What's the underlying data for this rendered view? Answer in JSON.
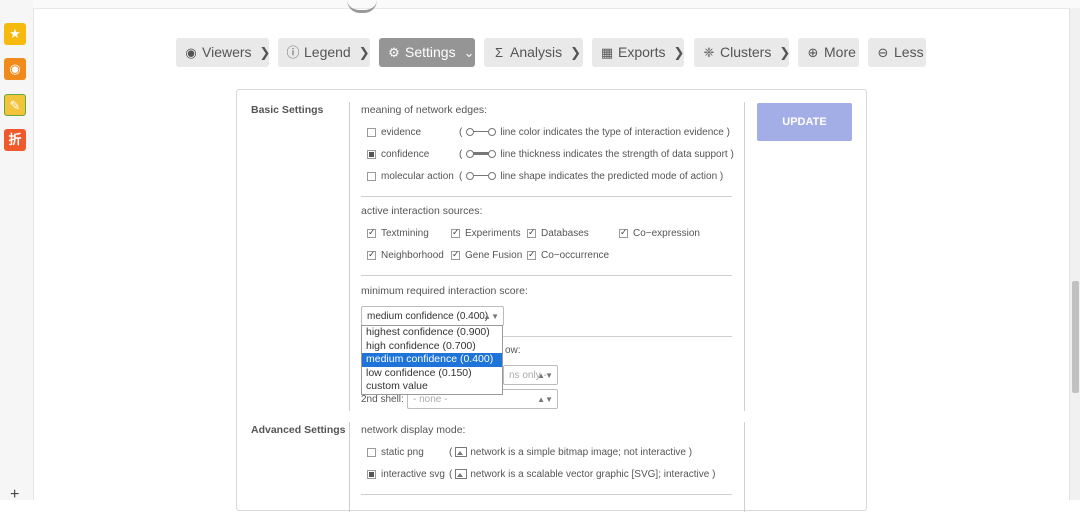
{
  "sidebar_rail": {
    "icons": [
      "star-icon",
      "weibo-icon",
      "notes-icon",
      "discount-icon"
    ],
    "discount_label": "折"
  },
  "menu": [
    {
      "label": "Viewers",
      "icon": "eye-icon",
      "glyph": "◉"
    },
    {
      "label": "Legend",
      "icon": "info-icon",
      "glyph": "ⓘ"
    },
    {
      "label": "Settings",
      "icon": "gear-icon",
      "glyph": "⚙",
      "active": true
    },
    {
      "label": "Analysis",
      "icon": "sigma-icon",
      "glyph": "Σ"
    },
    {
      "label": "Exports",
      "icon": "table-icon",
      "glyph": "▦"
    },
    {
      "label": "Clusters",
      "icon": "cluster-icon",
      "glyph": "❈"
    },
    {
      "label": "More",
      "icon": "plus-circle-icon",
      "glyph": "⊕"
    },
    {
      "label": "Less",
      "icon": "minus-circle-icon",
      "glyph": "⊖"
    }
  ],
  "basic_settings": {
    "title": "Basic Settings",
    "update_label": "UPDATE",
    "edges": {
      "title": "meaning of network edges:",
      "options": [
        {
          "label": "evidence",
          "desc": "line color indicates the type of interaction evidence",
          "checked": false
        },
        {
          "label": "confidence",
          "desc": "line thickness indicates the strength of data support",
          "checked": true
        },
        {
          "label": "molecular action",
          "desc": "line shape indicates the predicted mode of action",
          "checked": false
        }
      ]
    },
    "sources": {
      "title": "active interaction sources:",
      "items": [
        "Textmining",
        "Experiments",
        "Databases",
        "Co−expression",
        "Neighborhood",
        "Gene Fusion",
        "Co−occurrence"
      ]
    },
    "score": {
      "title": "minimum required interaction score:",
      "selected": "medium confidence (0.400)",
      "options": [
        "highest confidence (0.900)",
        "high confidence (0.700)",
        "medium confidence (0.400)",
        "low confidence (0.150)",
        "custom value"
      ]
    },
    "max_interactors": {
      "title_suffix": "ow:",
      "first_shell_value": "ns only -",
      "second_shell_label": "2nd shell:",
      "second_shell_value": "- none -"
    }
  },
  "advanced_settings": {
    "title": "Advanced Settings",
    "display_mode": {
      "title": "network display mode:",
      "options": [
        {
          "label": "static png",
          "desc": "network is a simple bitmap image; not interactive",
          "checked": false
        },
        {
          "label": "interactive svg",
          "desc": "network is a scalable vector graphic [SVG]; interactive",
          "checked": true
        }
      ]
    }
  }
}
